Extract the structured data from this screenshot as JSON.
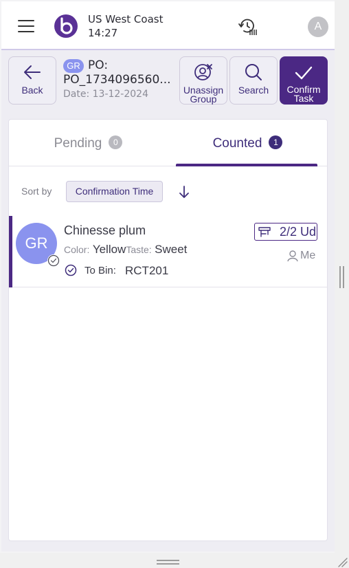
{
  "header": {
    "location": "US West Coast",
    "time": "14:27",
    "user_initial": "A"
  },
  "toolbar": {
    "back_label": "Back",
    "unassign_line1": "Unassign",
    "unassign_line2": "Group",
    "search_label": "Search",
    "confirm_line1": "Confirm",
    "confirm_line2": "Task"
  },
  "document": {
    "type_badge": "GR",
    "label": "PO:",
    "number": "PO_1734096560...",
    "date": "Date: 13-12-2024"
  },
  "tabs": [
    {
      "label": "Pending",
      "count": "0",
      "active": false
    },
    {
      "label": "Counted",
      "count": "1",
      "active": true
    }
  ],
  "sort": {
    "label": "Sort by",
    "field": "Confirmation Time",
    "direction": "descending"
  },
  "items": [
    {
      "avatar": "GR",
      "name": "Chinesse plum",
      "color_key": "Color:",
      "color_value": "Yellow",
      "taste_key": "Taste:",
      "taste_value": "Sweet",
      "bin_label": "To Bin:",
      "bin_value": "RCT201",
      "quantity": "2/2 Ud",
      "assignee": "Me"
    }
  ],
  "colors": {
    "accent": "#4b2884",
    "badge": "#8a93ee",
    "muted": "#8b8b96"
  }
}
